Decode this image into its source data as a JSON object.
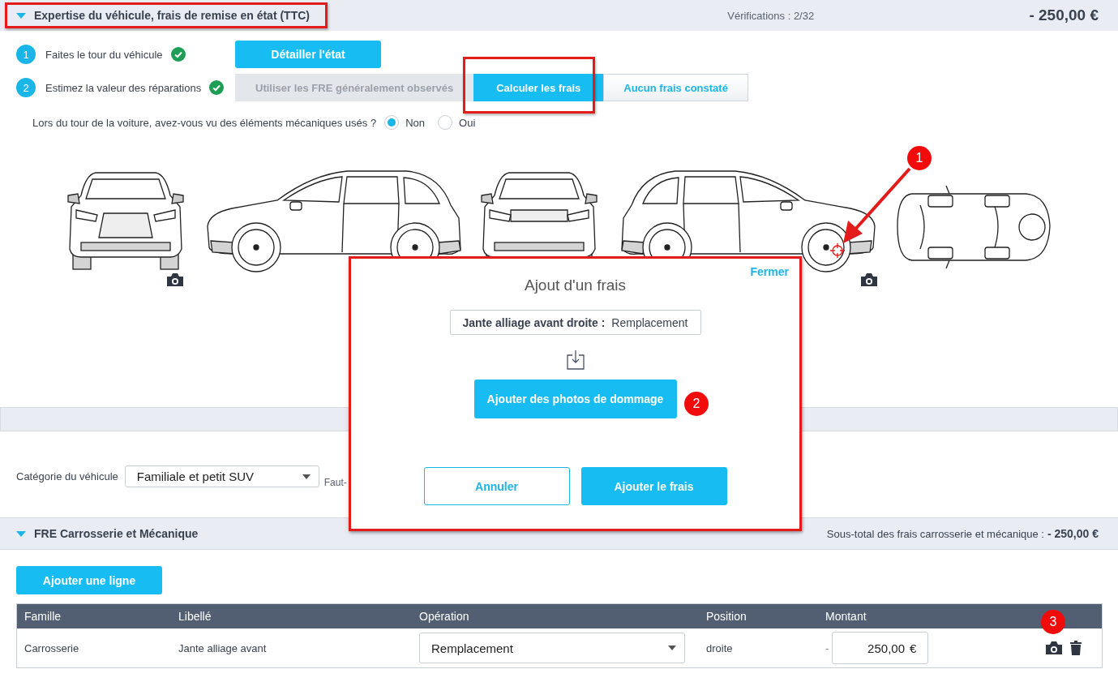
{
  "header": {
    "title": "Expertise du véhicule, frais de remise en état (TTC)",
    "expanded": true,
    "verifications": "Vérifications : 2/32",
    "total": "- 250,00 €"
  },
  "steps": [
    {
      "number": "1",
      "label": "Faites le tour du véhicule",
      "done": true
    },
    {
      "number": "2",
      "label": "Estimez la valeur des réparations",
      "done": true
    }
  ],
  "detail_button": "Détailler l'état",
  "estimate_options": [
    {
      "label": "Utiliser les FRE généralement observés",
      "selected": false,
      "disabled": true
    },
    {
      "label": "Calculer les frais",
      "selected": true,
      "disabled": false
    },
    {
      "label": "Aucun frais constaté",
      "selected": false,
      "disabled": false
    }
  ],
  "question": {
    "text": "Lors du tour de la voiture, avez-vous vu des éléments mécaniques usés ?",
    "options": [
      {
        "label": "Non",
        "selected": true
      },
      {
        "label": "Oui",
        "selected": false
      }
    ]
  },
  "category": {
    "label": "Catégorie du véhicule",
    "value": "Familiale et petit SUV",
    "next_label": "Faut-"
  },
  "section": {
    "title": "FRE Carrosserie et Mécanique",
    "expanded": true,
    "subtotal_label": "Sous-total des frais carrosserie et mécanique :",
    "subtotal": "- 250,00 €"
  },
  "add_line_button": "Ajouter une ligne",
  "table": {
    "columns": [
      "Famille",
      "Libellé",
      "Opération",
      "Position",
      "Montant"
    ],
    "rows": [
      {
        "famille": "Carrosserie",
        "libelle": "Jante alliage avant",
        "operation": "Remplacement",
        "position": "droite",
        "sign": "-",
        "amount": "250,00",
        "currency": "€"
      }
    ]
  },
  "modal": {
    "close": "Fermer",
    "title": "Ajout d'un frais",
    "item_label": "Jante alliage avant droite :",
    "item_value": "Remplacement",
    "upload_button": "Ajouter des photos de dommage",
    "cancel": "Annuler",
    "confirm": "Ajouter le frais"
  },
  "annotations": [
    {
      "number": "1"
    },
    {
      "number": "2"
    },
    {
      "number": "3"
    }
  ]
}
